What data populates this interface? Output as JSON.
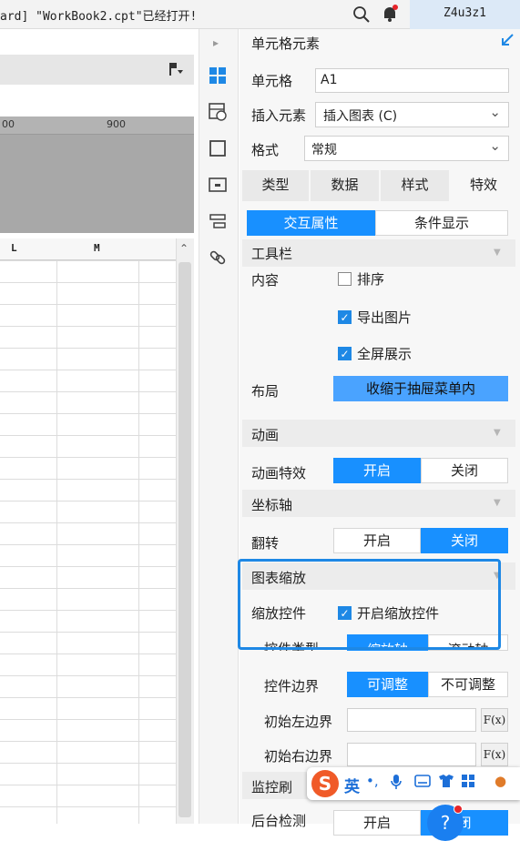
{
  "titlebar": {
    "text": "ard] \"WorkBook2.cpt\"已经打开!",
    "user": "Z4u3z1"
  },
  "ruler": {
    "ticks": [
      "00",
      "900"
    ]
  },
  "columns": [
    "L",
    "M"
  ],
  "panel": {
    "title": "单元格元素",
    "cell_label": "单元格",
    "cell_value": "A1",
    "insert_label": "插入元素",
    "insert_value": "插入图表 (C)",
    "format_label": "格式",
    "format_value": "常规",
    "tabs": [
      "类型",
      "数据",
      "样式",
      "特效"
    ],
    "subtabs": [
      "交互属性",
      "条件显示"
    ],
    "toolbar": {
      "title": "工具栏",
      "content_label": "内容",
      "options": [
        {
          "label": "排序",
          "checked": false
        },
        {
          "label": "导出图片",
          "checked": true
        },
        {
          "label": "全屏展示",
          "checked": true
        }
      ],
      "layout_label": "布局",
      "layout_value": "收缩于抽屉菜单内"
    },
    "animation": {
      "title": "动画",
      "effect_label": "动画特效",
      "on": "开启",
      "off": "关闭"
    },
    "axis": {
      "title": "坐标轴",
      "flip_label": "翻转",
      "on": "开启",
      "off": "关闭"
    },
    "zoom": {
      "title": "图表缩放",
      "control_label": "缩放控件",
      "enable_label": "开启缩放控件",
      "enable_checked": true,
      "type_label": "控件类型",
      "type_options": [
        "缩放轴",
        "滚动轴"
      ],
      "boundary_label": "控件边界",
      "boundary_options": [
        "可调整",
        "不可调整"
      ],
      "left_label": "初始左边界",
      "right_label": "初始右边界",
      "fx": "F(x)"
    },
    "monitor": {
      "title": "监控刷",
      "bg_label": "后台检测",
      "on": "开启",
      "off": "闭"
    }
  },
  "ime": {
    "logo": "S",
    "lang": "英"
  },
  "help": {
    "label": "?"
  },
  "colors": {
    "accent": "#1890ff",
    "highlight": "#1e88e5",
    "ime_logo": "#f05a28"
  }
}
